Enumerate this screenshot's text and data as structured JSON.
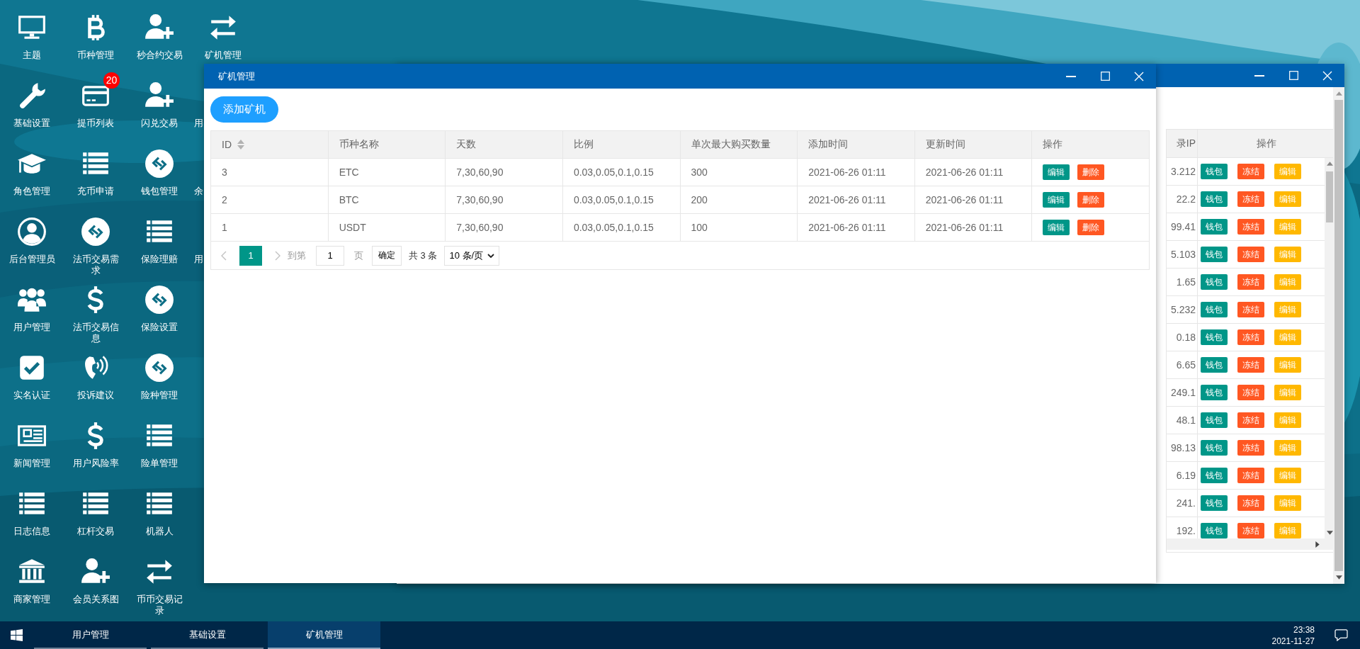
{
  "desktop": {
    "icons": [
      {
        "label": "主题",
        "kind": "monitor"
      },
      {
        "label": "基础设置",
        "kind": "wrench"
      },
      {
        "label": "角色管理",
        "kind": "cap"
      },
      {
        "label": "后台管理员",
        "kind": "user-circle"
      },
      {
        "label": "用户管理",
        "kind": "users"
      },
      {
        "label": "实名认证",
        "kind": "check"
      },
      {
        "label": "新闻管理",
        "kind": "news"
      },
      {
        "label": "日志信息",
        "kind": "list"
      },
      {
        "label": "商家管理",
        "kind": "bank"
      },
      {
        "label": "币种管理",
        "kind": "bitcoin"
      },
      {
        "label": "提币列表",
        "kind": "card",
        "badge": "20"
      },
      {
        "label": "充币申请",
        "kind": "list"
      },
      {
        "label": "法币交易需求",
        "kind": "chain"
      },
      {
        "label": "法币交易信息",
        "kind": "dollar"
      },
      {
        "label": "投诉建议",
        "kind": "phone"
      },
      {
        "label": "用户风险率",
        "kind": "dollar"
      },
      {
        "label": "杠杆交易",
        "kind": "list"
      },
      {
        "label": "会员关系图",
        "kind": "user-plus"
      },
      {
        "label": "秒合约交易",
        "kind": "user-plus"
      },
      {
        "label": "闪兑交易",
        "kind": "user-plus"
      },
      {
        "label": "钱包管理",
        "kind": "chain"
      },
      {
        "label": "保险理赔",
        "kind": "list"
      },
      {
        "label": "保险设置",
        "kind": "chain"
      },
      {
        "label": "险种管理",
        "kind": "chain"
      },
      {
        "label": "险单管理",
        "kind": "list"
      },
      {
        "label": "机器人",
        "kind": "list"
      },
      {
        "label": "币币交易记录",
        "kind": "swap"
      },
      {
        "label": "矿机管理",
        "kind": "swap"
      },
      {
        "label": "用",
        "kind": "cut"
      },
      {
        "label": "余",
        "kind": "cut"
      },
      {
        "label": "用",
        "kind": "cut"
      }
    ]
  },
  "back_window": {
    "table": {
      "columns": [
        {
          "label": "录IP"
        },
        {
          "label": "操作"
        }
      ],
      "rows": [
        {
          "ip": "3.212",
          "actions": [
            {
              "label": "钱包",
              "kind": "primary"
            },
            {
              "label": "冻结",
              "kind": "danger"
            },
            {
              "label": "编辑",
              "kind": "warm"
            }
          ]
        },
        {
          "ip": "22.2",
          "actions": [
            {
              "label": "钱包",
              "kind": "primary"
            },
            {
              "label": "冻结",
              "kind": "danger"
            },
            {
              "label": "编辑",
              "kind": "warm"
            }
          ]
        },
        {
          "ip": "99.41",
          "actions": [
            {
              "label": "钱包",
              "kind": "primary"
            },
            {
              "label": "冻结",
              "kind": "danger"
            },
            {
              "label": "编辑",
              "kind": "warm"
            }
          ]
        },
        {
          "ip": "5.103",
          "actions": [
            {
              "label": "钱包",
              "kind": "primary"
            },
            {
              "label": "冻结",
              "kind": "danger"
            },
            {
              "label": "编辑",
              "kind": "warm"
            }
          ]
        },
        {
          "ip": "1.65",
          "actions": [
            {
              "label": "钱包",
              "kind": "primary"
            },
            {
              "label": "冻结",
              "kind": "danger"
            },
            {
              "label": "编辑",
              "kind": "warm"
            }
          ]
        },
        {
          "ip": "5.232",
          "actions": [
            {
              "label": "钱包",
              "kind": "primary"
            },
            {
              "label": "冻结",
              "kind": "danger"
            },
            {
              "label": "编辑",
              "kind": "warm"
            }
          ]
        },
        {
          "ip": "0.18",
          "actions": [
            {
              "label": "钱包",
              "kind": "primary"
            },
            {
              "label": "冻结",
              "kind": "danger"
            },
            {
              "label": "编辑",
              "kind": "warm"
            }
          ]
        },
        {
          "ip": "6.65",
          "actions": [
            {
              "label": "钱包",
              "kind": "primary"
            },
            {
              "label": "冻结",
              "kind": "danger"
            },
            {
              "label": "编辑",
              "kind": "warm"
            }
          ]
        },
        {
          "ip": "249.1",
          "actions": [
            {
              "label": "钱包",
              "kind": "primary"
            },
            {
              "label": "冻结",
              "kind": "danger"
            },
            {
              "label": "编辑",
              "kind": "warm"
            }
          ]
        },
        {
          "ip": "48.1",
          "actions": [
            {
              "label": "钱包",
              "kind": "primary"
            },
            {
              "label": "冻结",
              "kind": "danger"
            },
            {
              "label": "编辑",
              "kind": "warm"
            }
          ]
        },
        {
          "ip": "98.13",
          "actions": [
            {
              "label": "钱包",
              "kind": "primary"
            },
            {
              "label": "冻结",
              "kind": "danger"
            },
            {
              "label": "编辑",
              "kind": "warm"
            }
          ]
        },
        {
          "ip": "6.19",
          "actions": [
            {
              "label": "钱包",
              "kind": "primary"
            },
            {
              "label": "冻结",
              "kind": "danger"
            },
            {
              "label": "编辑",
              "kind": "warm"
            }
          ]
        },
        {
          "ip": "241.",
          "actions": [
            {
              "label": "钱包",
              "kind": "primary"
            },
            {
              "label": "冻结",
              "kind": "danger"
            },
            {
              "label": "编辑",
              "kind": "warm"
            }
          ]
        },
        {
          "ip": "192.",
          "actions": [
            {
              "label": "钱包",
              "kind": "primary"
            },
            {
              "label": "冻结",
              "kind": "danger"
            },
            {
              "label": "编辑",
              "kind": "warm"
            }
          ]
        }
      ]
    }
  },
  "front_window": {
    "title": "矿机管理",
    "add_button": "添加矿机",
    "table": {
      "columns": [
        {
          "label": "ID",
          "sortable": true
        },
        {
          "label": "币种名称",
          "sortable": false
        },
        {
          "label": "天数",
          "sortable": false
        },
        {
          "label": "比例",
          "sortable": false
        },
        {
          "label": "单次最大购买数量",
          "sortable": false
        },
        {
          "label": "添加时间",
          "sortable": false
        },
        {
          "label": "更新时间",
          "sortable": false
        },
        {
          "label": "操作",
          "sortable": false
        }
      ],
      "rows": [
        {
          "cells": [
            "3",
            "ETC",
            "7,30,60,90",
            "0.03,0.05,0.1,0.15",
            "300",
            "2021-06-26 01:11",
            "2021-06-26 01:11"
          ],
          "actions": [
            {
              "label": "编辑",
              "kind": "primary"
            },
            {
              "label": "删除",
              "kind": "danger"
            }
          ]
        },
        {
          "cells": [
            "2",
            "BTC",
            "7,30,60,90",
            "0.03,0.05,0.1,0.15",
            "200",
            "2021-06-26 01:11",
            "2021-06-26 01:11"
          ],
          "actions": [
            {
              "label": "编辑",
              "kind": "primary"
            },
            {
              "label": "删除",
              "kind": "danger"
            }
          ]
        },
        {
          "cells": [
            "1",
            "USDT",
            "7,30,60,90",
            "0.03,0.05,0.1,0.15",
            "100",
            "2021-06-26 01:11",
            "2021-06-26 01:11"
          ],
          "actions": [
            {
              "label": "编辑",
              "kind": "primary"
            },
            {
              "label": "删除",
              "kind": "danger"
            }
          ]
        }
      ]
    },
    "pagination": {
      "pages": [
        {
          "label": "1",
          "selected": true
        }
      ],
      "goto_label": "到第",
      "goto_value": "1",
      "page_label": "页",
      "confirm": "确定",
      "total": "共 3 条",
      "page_size": "10 条/页"
    }
  },
  "taskbar": {
    "tasks": [
      {
        "label": "用户管理",
        "selected": false
      },
      {
        "label": "基础设置",
        "selected": false
      },
      {
        "label": "矿机管理",
        "selected": true
      }
    ],
    "clock": {
      "time": "23:38",
      "date": "2021-11-27"
    }
  }
}
